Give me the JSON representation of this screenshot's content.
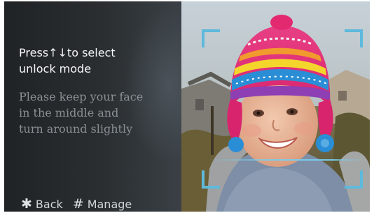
{
  "panel": {
    "title_lines": [
      "Press↑↓to select",
      "unlock mode"
    ],
    "hint_lines": [
      "Please keep your face",
      "in the middle and",
      "turn around slightly"
    ]
  },
  "footer": {
    "back": {
      "icon": "✱",
      "label": "Back"
    },
    "manage": {
      "icon": "#",
      "label": "Manage"
    }
  },
  "colors": {
    "frame_accent": "#5eb9dc",
    "title_text": "#f4f6f7",
    "hint_text": "#8a9096"
  }
}
